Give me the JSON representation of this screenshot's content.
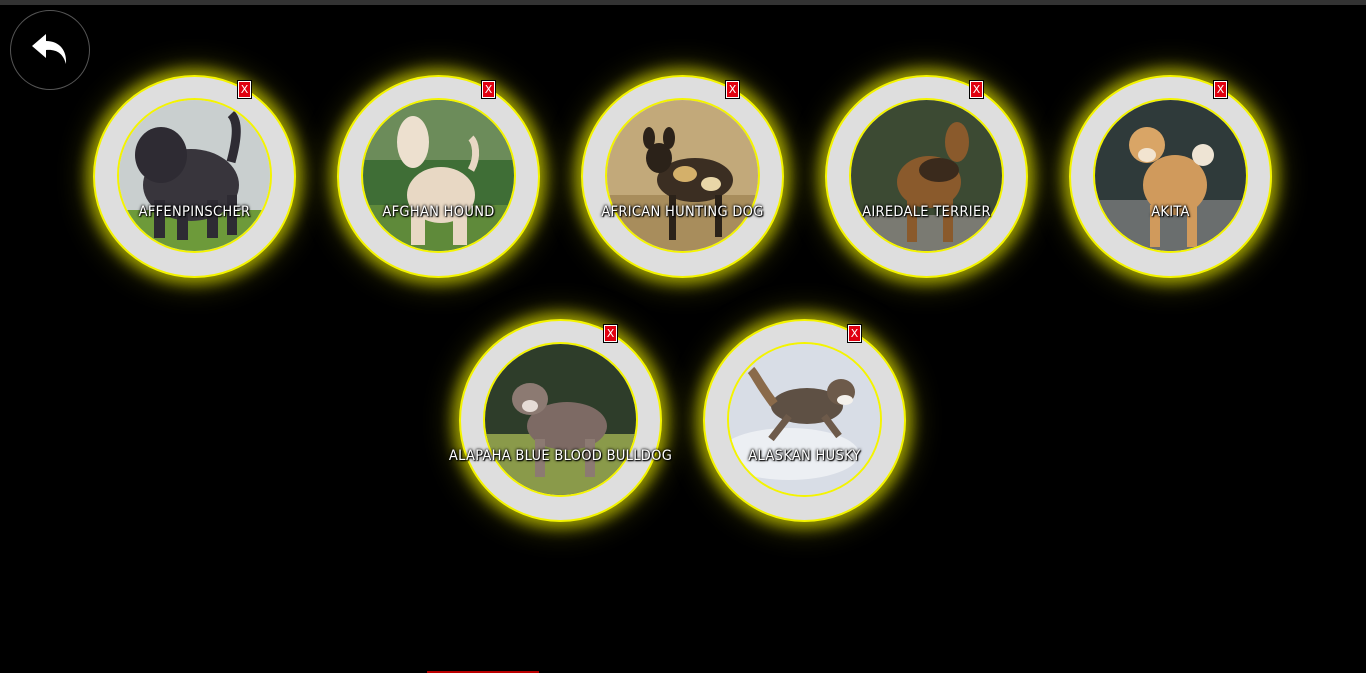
{
  "nav": {
    "back_icon": "undo-arrow-icon"
  },
  "breeds": [
    {
      "name": "AFFENPINSCHER",
      "remove_label": "X"
    },
    {
      "name": "AFGHAN HOUND",
      "remove_label": "X"
    },
    {
      "name": "AFRICAN HUNTING DOG",
      "remove_label": "X"
    },
    {
      "name": "AIREDALE TERRIER",
      "remove_label": "X"
    },
    {
      "name": "AKITA",
      "remove_label": "X"
    },
    {
      "name": "ALAPAHA BLUE BLOOD BULLDOG",
      "remove_label": "X"
    },
    {
      "name": "ALASKAN HUSKY",
      "remove_label": "X"
    }
  ],
  "colors": {
    "background": "#000000",
    "ring": "#dedede",
    "glow": "#f4f400",
    "remove": "#e00010"
  }
}
